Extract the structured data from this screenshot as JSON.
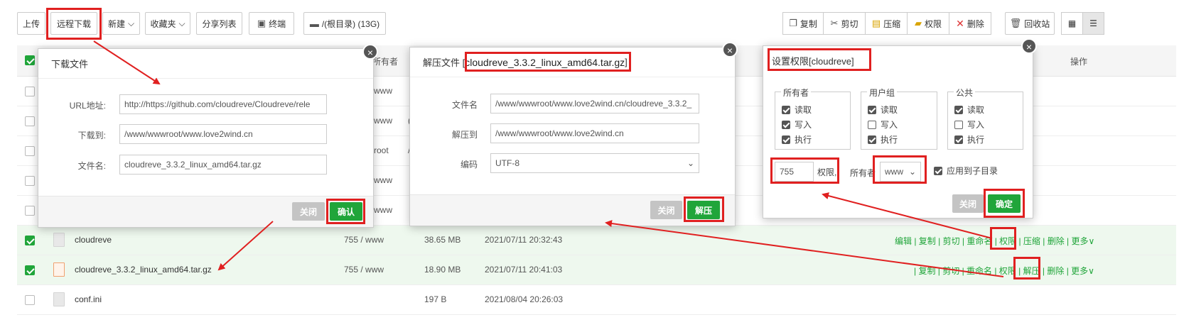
{
  "toolbar": {
    "upload": "上传",
    "remote_download": "远程下载",
    "new": "新建",
    "favorites": "收藏夹",
    "share_list": "分享列表",
    "terminal": "终端",
    "path": "/(根目录) (13G)",
    "copy": "复制",
    "cut": "剪切",
    "compress": "压缩",
    "permission": "权限",
    "delete": "删除",
    "recycle": "回收站"
  },
  "table": {
    "col_owner": "所有者",
    "col_ops": "操作",
    "partial_rows": [
      {
        "owner": "www",
        "mid": ""
      },
      {
        "owner": "www",
        "mid": "("
      },
      {
        "owner": "root",
        "mid": "/"
      },
      {
        "owner": "www",
        "mid": ""
      },
      {
        "owner": "www",
        "mid": ""
      }
    ],
    "rows": [
      {
        "name": "cloudreve",
        "perm": "755 / www",
        "size": "38.65 MB",
        "time": "2021/07/11 20:32:43",
        "ops": "编辑 | 复制 | 剪切 | 重命名 | 权限 | 压缩 | 删除 | 更多∨",
        "checked": true
      },
      {
        "name": "cloudreve_3.3.2_linux_amd64.tar.gz",
        "perm": "755 / www",
        "size": "18.90 MB",
        "time": "2021/07/11 20:41:03",
        "ops": "| 复制 | 剪切 | 重命名 | 权限 | 解压 | 删除 | 更多∨",
        "checked": true
      },
      {
        "name": "conf.ini",
        "perm": "",
        "size": "197 B",
        "time": "2021/08/04 20:26:03",
        "ops": "",
        "checked": false
      }
    ]
  },
  "download_modal": {
    "title": "下载文件",
    "url_label": "URL地址:",
    "url_value": "http://https://github.com/cloudreve/Cloudreve/rele",
    "dest_label": "下载到:",
    "dest_value": "/www/wwwroot/www.love2wind.cn",
    "name_label": "文件名:",
    "name_value": "cloudreve_3.3.2_linux_amd64.tar.gz",
    "close": "关闭",
    "confirm": "确认"
  },
  "extract_modal": {
    "title_prefix": "解压文件 [",
    "title_file": "cloudreve_3.3.2_linux_amd64.tar.gz",
    "title_suffix": "]",
    "file_label": "文件名",
    "file_value": "/www/wwwroot/www.love2wind.cn/cloudreve_3.3.2_",
    "to_label": "解压到",
    "to_value": "/www/wwwroot/www.love2wind.cn",
    "enc_label": "编码",
    "enc_value": "UTF-8",
    "close": "关闭",
    "confirm": "解压"
  },
  "perm_modal": {
    "title": "设置权限[cloudreve]",
    "groups": [
      {
        "legend": "所有者",
        "items": [
          {
            "label": "读取",
            "on": true
          },
          {
            "label": "写入",
            "on": true
          },
          {
            "label": "执行",
            "on": true
          }
        ]
      },
      {
        "legend": "用户组",
        "items": [
          {
            "label": "读取",
            "on": true
          },
          {
            "label": "写入",
            "on": false
          },
          {
            "label": "执行",
            "on": true
          }
        ]
      },
      {
        "legend": "公共",
        "items": [
          {
            "label": "读取",
            "on": true
          },
          {
            "label": "写入",
            "on": false
          },
          {
            "label": "执行",
            "on": true
          }
        ]
      }
    ],
    "perm_value": "755",
    "perm_label": "权限,",
    "owner_label": "所有者",
    "owner_value": "www",
    "apply_sub": "应用到子目录",
    "close": "关闭",
    "confirm": "确定"
  },
  "colors": {
    "accent": "#20a53a",
    "annotation": "#e02020"
  }
}
